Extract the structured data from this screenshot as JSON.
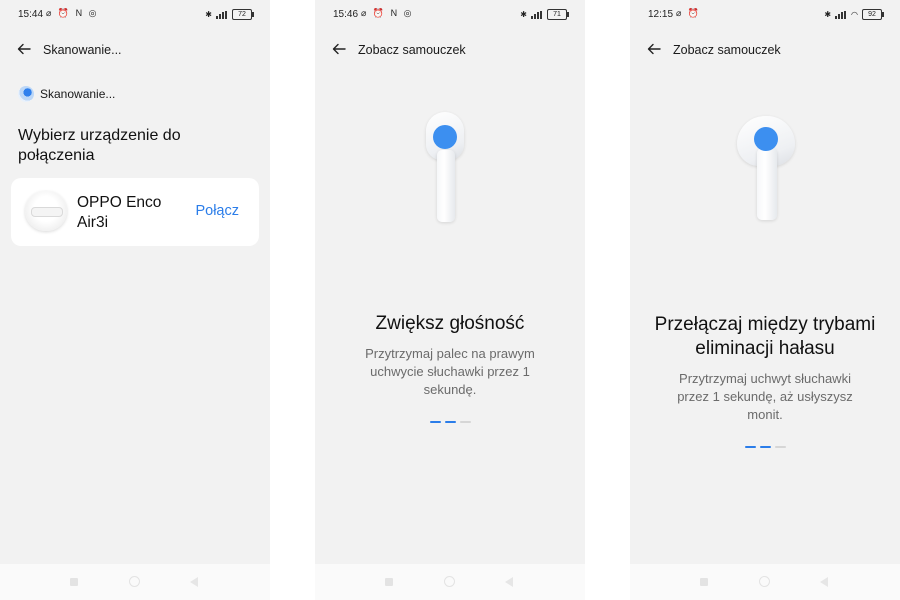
{
  "screens": [
    {
      "status": {
        "time": "15:44",
        "battery": "72"
      },
      "appbar_title": "Skanowanie...",
      "scanning_label": "Skanowanie...",
      "heading": "Wybierz urządzenie do połączenia",
      "device": {
        "name": "OPPO Enco Air3i",
        "action": "Połącz"
      }
    },
    {
      "status": {
        "time": "15:46",
        "battery": "71"
      },
      "appbar_title": "Zobacz samouczek",
      "title": "Zwiększ głośność",
      "description": "Przytrzymaj palec na prawym uchwycie słuchawki przez 1 sekundę.",
      "page_indicator": {
        "total": 3,
        "active": 2
      }
    },
    {
      "status": {
        "time": "12:15",
        "battery": "92"
      },
      "appbar_title": "Zobacz samouczek",
      "title": "Przełączaj między trybami eliminacji hałasu",
      "description": "Przytrzymaj uchwyt słuchawki przez 1 sekundę, aż usłyszysz monit.",
      "page_indicator": {
        "total": 3,
        "active": 2
      }
    }
  ],
  "colors": {
    "accent": "#2b7de9",
    "background": "#f2f2f2",
    "card": "#ffffff"
  }
}
